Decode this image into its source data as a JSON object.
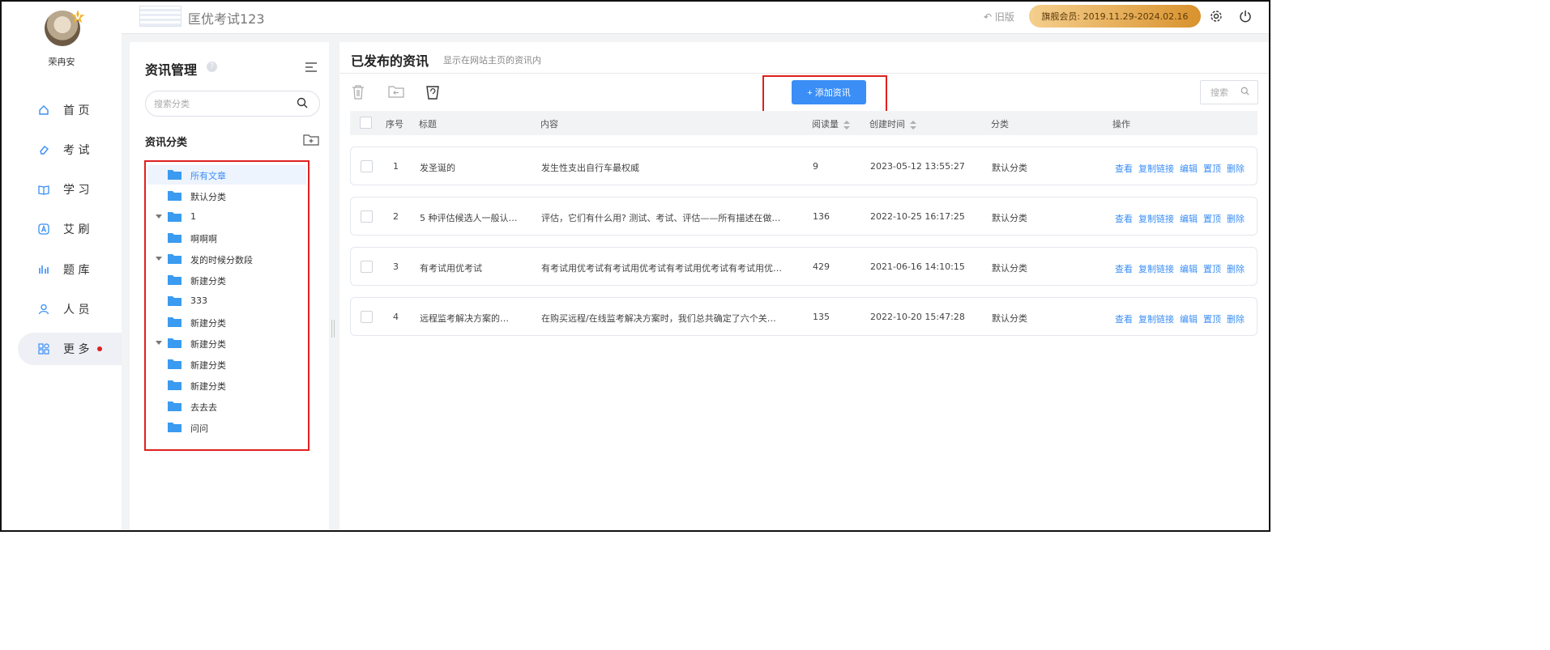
{
  "user": {
    "name": "荣冉安",
    "badge": "V"
  },
  "nav": [
    {
      "label": "首 页",
      "icon": "home-icon"
    },
    {
      "label": "考 试",
      "icon": "eraser-icon"
    },
    {
      "label": "学 习",
      "icon": "book-icon"
    },
    {
      "label": "艾 刷",
      "icon": "a-letter-icon"
    },
    {
      "label": "题 库",
      "icon": "bar-chart-icon"
    },
    {
      "label": "人 员",
      "icon": "person-icon"
    },
    {
      "label": "更 多",
      "icon": "apps-icon"
    }
  ],
  "topbar": {
    "app_title": "匡优考试123",
    "old_version": "旧版",
    "membership": "旗舰会员: 2019.11.29-2024.02.16"
  },
  "category_panel": {
    "title": "资讯管理",
    "search_placeholder": "搜索分类",
    "subtitle": "资讯分类",
    "tree": [
      {
        "label": "所有文章",
        "selected": true,
        "expandable": false
      },
      {
        "label": "默认分类",
        "selected": false,
        "expandable": false
      },
      {
        "label": "1",
        "selected": false,
        "expandable": true
      },
      {
        "label": "啊啊啊",
        "selected": false,
        "expandable": false
      },
      {
        "label": "发的时候分数段",
        "selected": false,
        "expandable": true
      },
      {
        "label": "新建分类",
        "selected": false,
        "expandable": false
      },
      {
        "label": "333",
        "selected": false,
        "expandable": false
      },
      {
        "label": "新建分类",
        "selected": false,
        "expandable": false
      },
      {
        "label": "新建分类",
        "selected": false,
        "expandable": true
      },
      {
        "label": "新建分类",
        "selected": false,
        "expandable": false
      },
      {
        "label": "新建分类",
        "selected": false,
        "expandable": false
      },
      {
        "label": "去去去",
        "selected": false,
        "expandable": false
      },
      {
        "label": "问问",
        "selected": false,
        "expandable": false
      }
    ]
  },
  "main": {
    "title": "已发布的资讯",
    "subtitle": "显示在网站主页的资讯内",
    "add_button": "+ 添加资讯",
    "search_placeholder": "搜索",
    "columns": {
      "index": "序号",
      "title": "标题",
      "content": "内容",
      "reads": "阅读量",
      "created": "创建时间",
      "category": "分类",
      "actions": "操作"
    },
    "rows": [
      {
        "index": "1",
        "title": "发圣诞的",
        "content": "发生性支出自行车最权威",
        "reads": "9",
        "created": "2023-05-12 13:55:27",
        "category": "默认分类"
      },
      {
        "index": "2",
        "title": "5 种评估候选人一般认…",
        "content": "评估，它们有什么用? 测试、考试、评估——所有描述在做…",
        "reads": "136",
        "created": "2022-10-25 16:17:25",
        "category": "默认分类"
      },
      {
        "index": "3",
        "title": "有考试用优考试",
        "content": "有考试用优考试有考试用优考试有考试用优考试有考试用优…",
        "reads": "429",
        "created": "2021-06-16 14:10:15",
        "category": "默认分类"
      },
      {
        "index": "4",
        "title": "远程监考解决方案的…",
        "content": "在购买远程/在线监考解决方案时，我们总共确定了六个关…",
        "reads": "135",
        "created": "2022-10-20 15:47:28",
        "category": "默认分类"
      }
    ],
    "row_actions": [
      "查看",
      "复制链接",
      "编辑",
      "置顶",
      "删除"
    ]
  },
  "colors": {
    "accent": "#3a8ef6",
    "highlight": "#e02020",
    "member_gold": "#d9922d"
  }
}
